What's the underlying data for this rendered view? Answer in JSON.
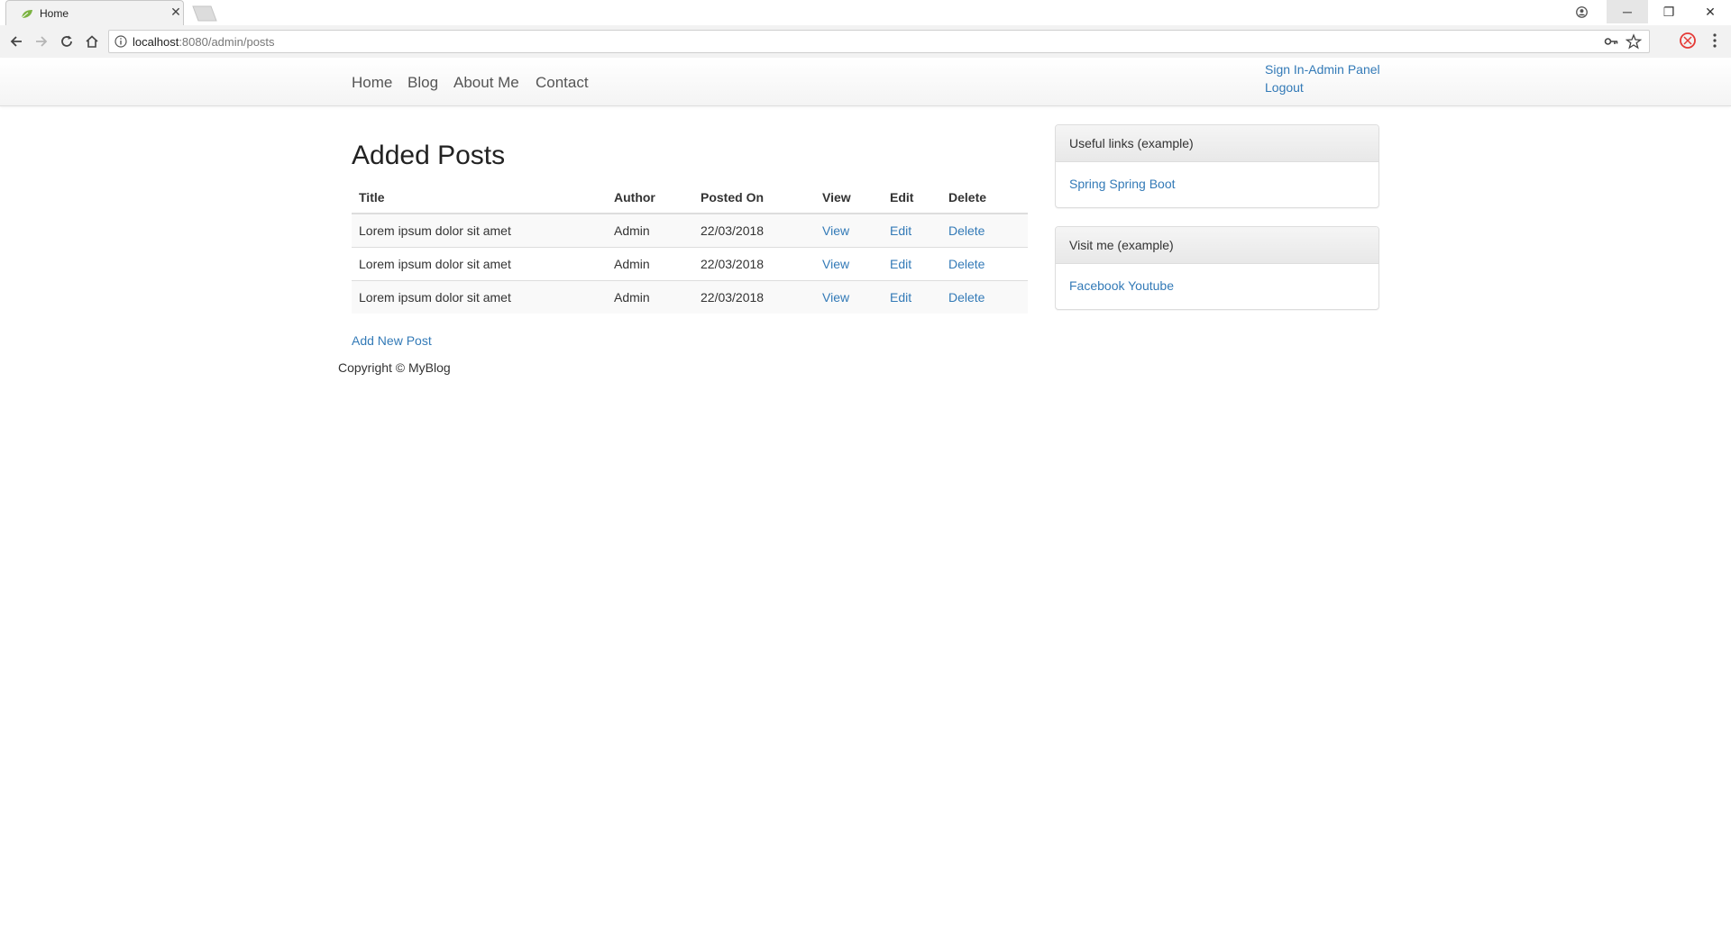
{
  "browser": {
    "tab_title": "Home",
    "url_host": "localhost",
    "url_rest": ":8080/admin/posts",
    "tab_close": "✕",
    "window_controls": {
      "minimize": "─",
      "maximize": "❐",
      "close": "✕"
    }
  },
  "nav": {
    "items": [
      "Home",
      "Blog",
      "About Me",
      "Contact"
    ],
    "sign_in": "Sign In-Admin Panel",
    "logout": "Logout"
  },
  "main": {
    "title": "Added Posts",
    "table": {
      "headers": [
        "Title",
        "Author",
        "Posted On",
        "View",
        "Edit",
        "Delete"
      ],
      "rows": [
        {
          "title": "Lorem ipsum dolor sit amet",
          "author": "Admin",
          "posted_on": "22/03/2018",
          "view": "View",
          "edit": "Edit",
          "delete": "Delete"
        },
        {
          "title": "Lorem ipsum dolor sit amet",
          "author": "Admin",
          "posted_on": "22/03/2018",
          "view": "View",
          "edit": "Edit",
          "delete": "Delete"
        },
        {
          "title": "Lorem ipsum dolor sit amet",
          "author": "Admin",
          "posted_on": "22/03/2018",
          "view": "View",
          "edit": "Edit",
          "delete": "Delete"
        }
      ]
    },
    "add_new_post": "Add New Post",
    "copyright": "Copyright © MyBlog"
  },
  "sidebar": {
    "panels": [
      {
        "heading": "Useful links (example)",
        "links": [
          "Spring",
          "Spring Boot"
        ]
      },
      {
        "heading": "Visit me (example)",
        "links": [
          "Facebook",
          "Youtube"
        ]
      }
    ]
  },
  "colors": {
    "link": "#337ab7",
    "text": "#333333",
    "nav_text": "#555555"
  }
}
